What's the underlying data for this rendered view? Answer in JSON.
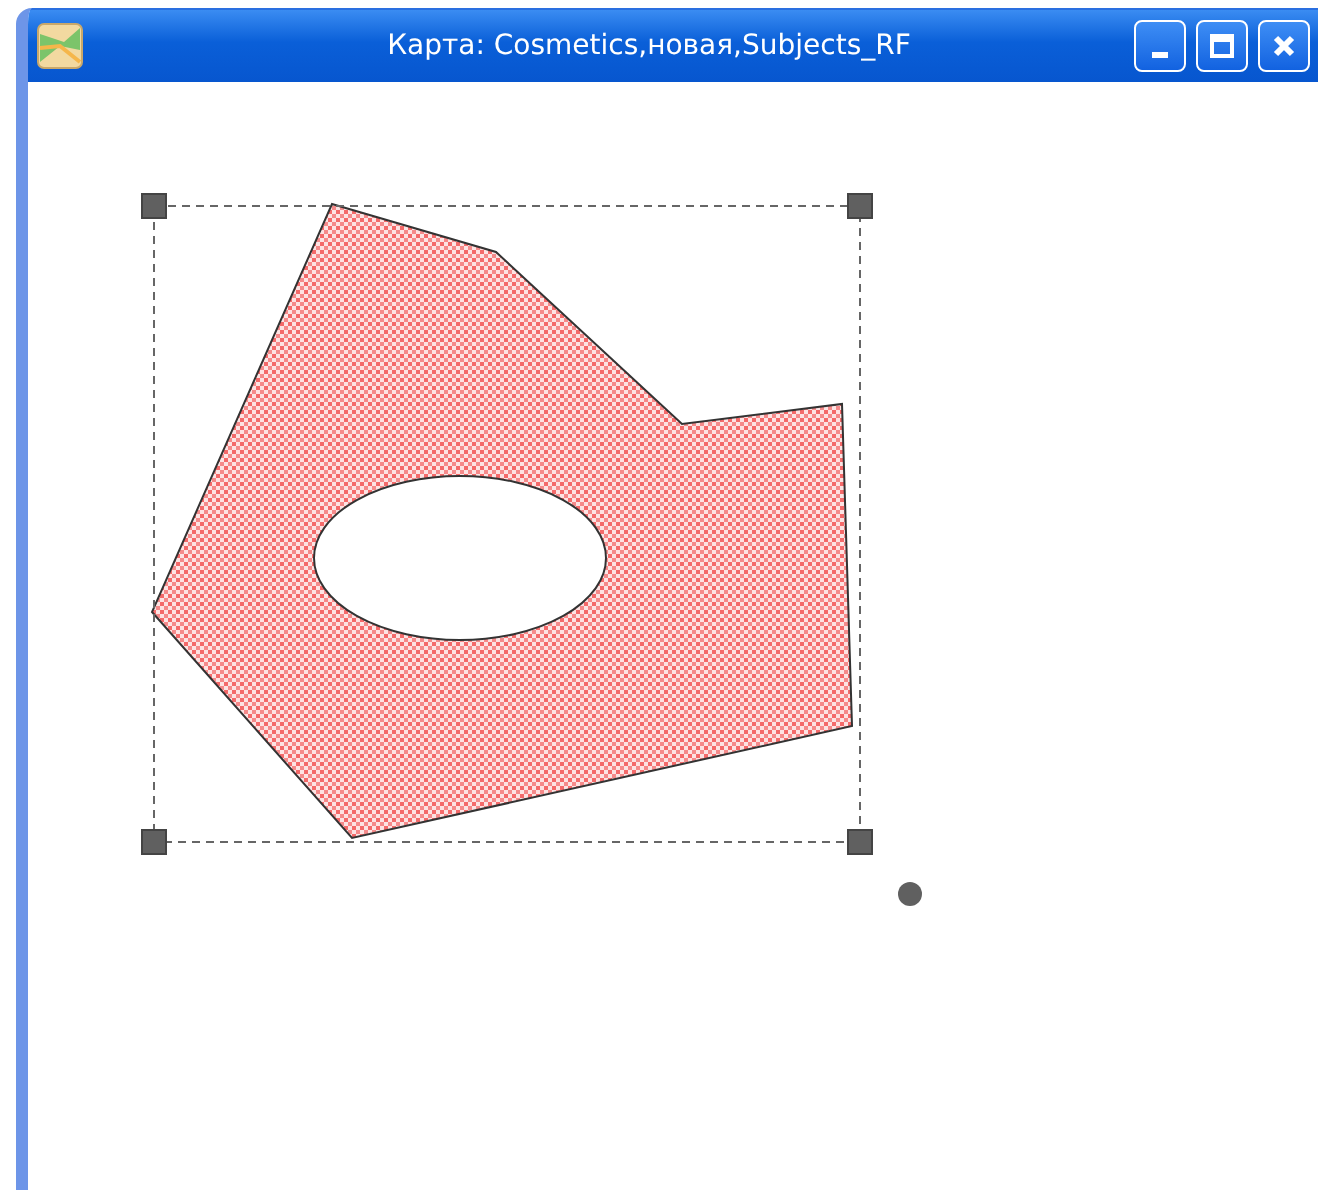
{
  "window": {
    "title": "Карта: Cosmetics,новая,Subjects_RF"
  },
  "map_object": {
    "selected": true
  }
}
